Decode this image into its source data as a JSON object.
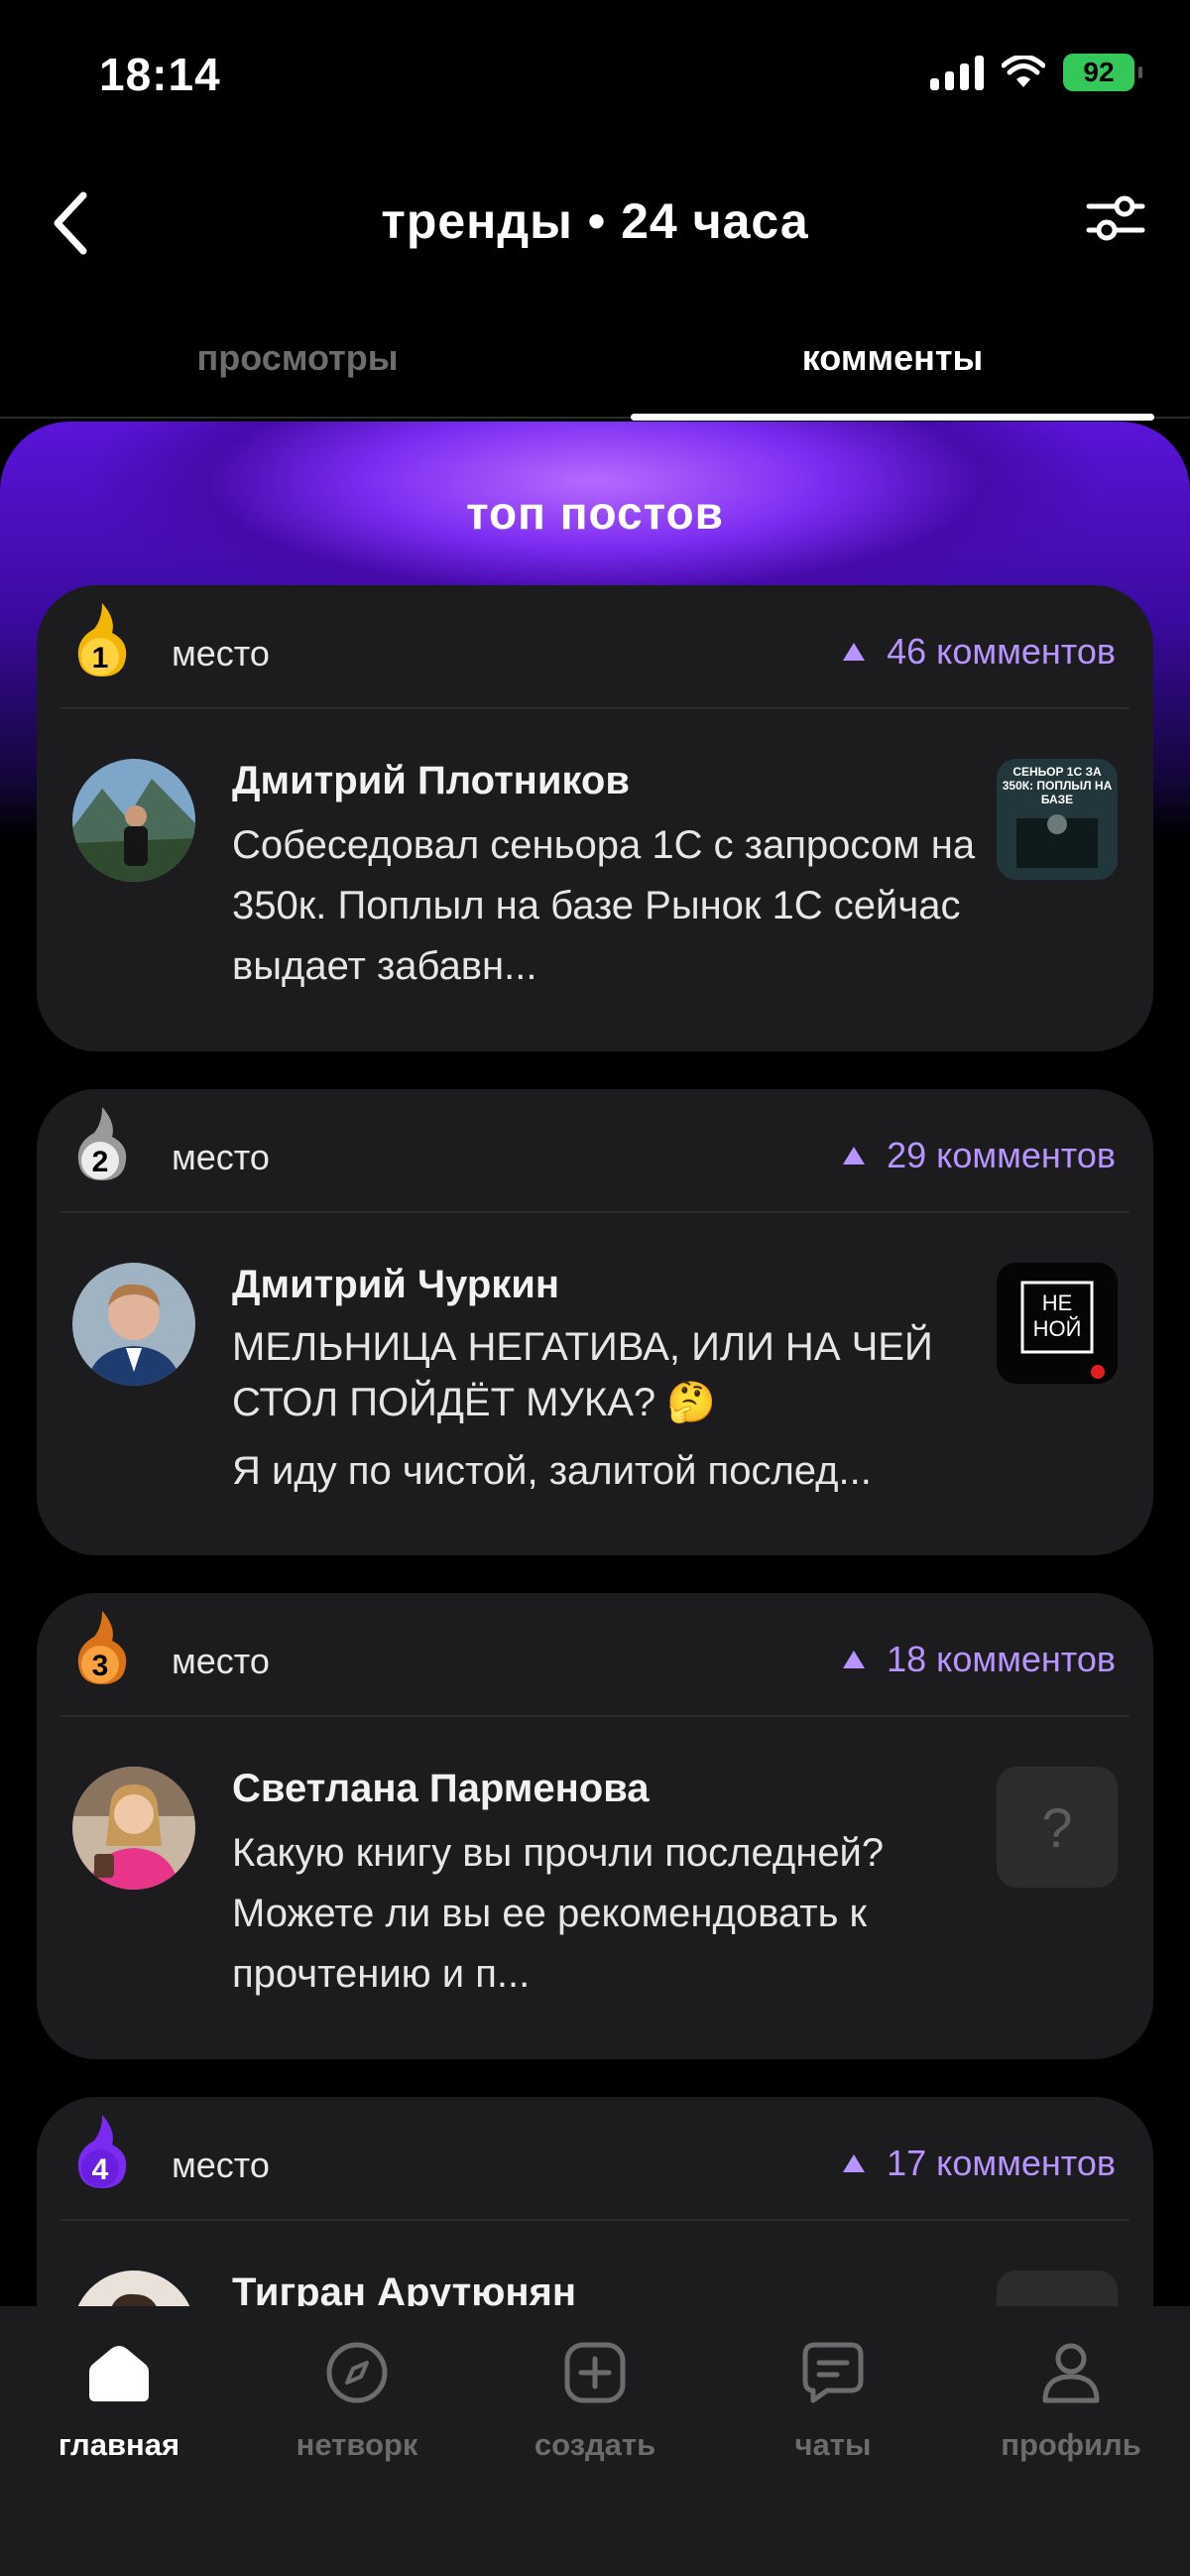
{
  "status_bar": {
    "time": "18:14",
    "battery": "92"
  },
  "header": {
    "title": "тренды • 24 часа"
  },
  "tabs": [
    {
      "label": "просмотры",
      "active": false
    },
    {
      "label": "комменты",
      "active": true
    }
  ],
  "section": {
    "title": "топ постов"
  },
  "posts": [
    {
      "rank": "1",
      "rank_color": "#f2b705",
      "place_label": "место",
      "comments": "46 комментов",
      "author": "Дмитрий Плотников",
      "text": "Собеседовал сеньора 1С с запросом на 350к. Поплыл на базе Рынок 1С сейчас выдает забавн...",
      "thumb_text": "СЕНЬОР 1С ЗА 350К: ПОПЛЫЛ НА БАЗЕ"
    },
    {
      "rank": "2",
      "rank_color": "#9a9a9a",
      "place_label": "место",
      "comments": "29 комментов",
      "author": "Дмитрий Чуркин",
      "text": "МЕЛЬНИЦА НЕГАТИВА, ИЛИ НА ЧЕЙ СТОЛ ПОЙДЁТ МУКА? 🤔",
      "text2": "Я иду по чистой, залитой послед...",
      "thumb_text": "НЕ НОЙ"
    },
    {
      "rank": "3",
      "rank_color": "#f08a24",
      "place_label": "место",
      "comments": "18 комментов",
      "author": "Светлана Парменова",
      "text": "Какую книгу вы прочли последней? Можете ли вы ее рекомендовать к прочтению и п...",
      "thumb_text": "?"
    },
    {
      "rank": "4",
      "rank_color": "#7b2bf0",
      "place_label": "место",
      "comments": "17 комментов",
      "author": "Тигран Арутюнян"
    }
  ],
  "nav": [
    {
      "label": "главная",
      "icon": "home-icon",
      "active": true
    },
    {
      "label": "нетворк",
      "icon": "compass-icon",
      "active": false
    },
    {
      "label": "создать",
      "icon": "plus-square-icon",
      "active": false
    },
    {
      "label": "чаты",
      "icon": "chat-icon",
      "active": false
    },
    {
      "label": "профиль",
      "icon": "profile-icon",
      "active": false
    }
  ]
}
